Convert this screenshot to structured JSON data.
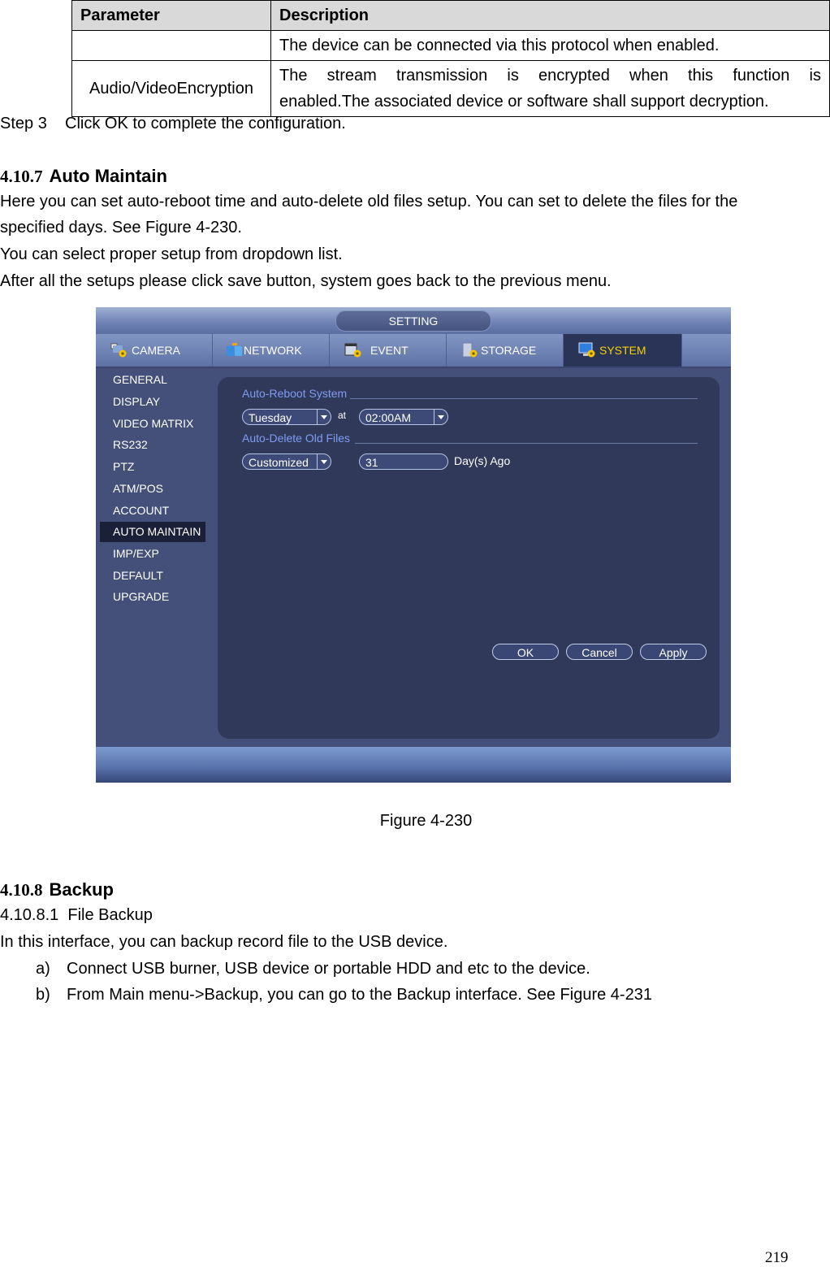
{
  "table": {
    "headers": [
      "Parameter",
      "Description"
    ],
    "rows": [
      {
        "parameter": "",
        "description": "The device can be connected via this protocol when enabled."
      },
      {
        "parameter": "Audio/VideoEncryption",
        "description_line1": "The stream transmission is encrypted when this function is",
        "description_line2": "enabled.The associated device or software shall support decryption."
      }
    ]
  },
  "step3": "Step 3    Click OK to complete the configuration.",
  "section_4107": {
    "number": "4.10.7",
    "title": "Auto Maintain",
    "para1_line1": "Here you can set auto-reboot time and auto-delete old files setup. You can set to delete the files for the",
    "para1_line2": "specified days. See Figure 4-230.",
    "para2": "You can select proper setup from dropdown list.",
    "para3": "After all the setups please click save button, system goes back to the previous menu."
  },
  "screenshot": {
    "title": "SETTING",
    "tabs": [
      {
        "label": "CAMERA",
        "icon": "camera-gear-icon"
      },
      {
        "label": "NETWORK",
        "icon": "network-icon"
      },
      {
        "label": "EVENT",
        "icon": "event-gear-icon"
      },
      {
        "label": "STORAGE",
        "icon": "storage-gear-icon"
      },
      {
        "label": "SYSTEM",
        "icon": "system-monitor-icon",
        "active": true
      }
    ],
    "sidebar": [
      "GENERAL",
      "DISPLAY",
      "VIDEO MATRIX",
      "RS232",
      "PTZ",
      "ATM/POS",
      "ACCOUNT",
      "AUTO MAINTAIN",
      "IMP/EXP",
      "DEFAULT",
      "UPGRADE"
    ],
    "sidebar_active": "AUTO MAINTAIN",
    "auto_reboot": {
      "section_label": "Auto-Reboot System",
      "day_value": "Tuesday",
      "at_label": "at",
      "time_value": "02:00AM"
    },
    "auto_delete": {
      "section_label": "Auto-Delete Old Files",
      "mode_value": "Customized",
      "days_value": "31",
      "days_suffix": "Day(s) Ago"
    },
    "buttons": {
      "ok": "OK",
      "cancel": "Cancel",
      "apply": "Apply"
    },
    "colors": {
      "active_tab_text": "#f5d000",
      "section_label": "#7d9cf2",
      "panel_bg": "#44507a",
      "content_bg": "#31395a"
    }
  },
  "figure_caption": "Figure 4-230",
  "section_4108": {
    "number": "4.10.8",
    "title": "Backup",
    "subsection": "4.10.8.1  File Backup",
    "intro": "In this interface, you can backup record file to the USB device.",
    "items": [
      {
        "marker": "a)",
        "text": "Connect USB burner, USB device or portable HDD and etc to the device."
      },
      {
        "marker": "b)",
        "text": "From Main menu->Backup, you can go to the Backup interface. See Figure 4-231"
      }
    ]
  },
  "page_number": "219"
}
